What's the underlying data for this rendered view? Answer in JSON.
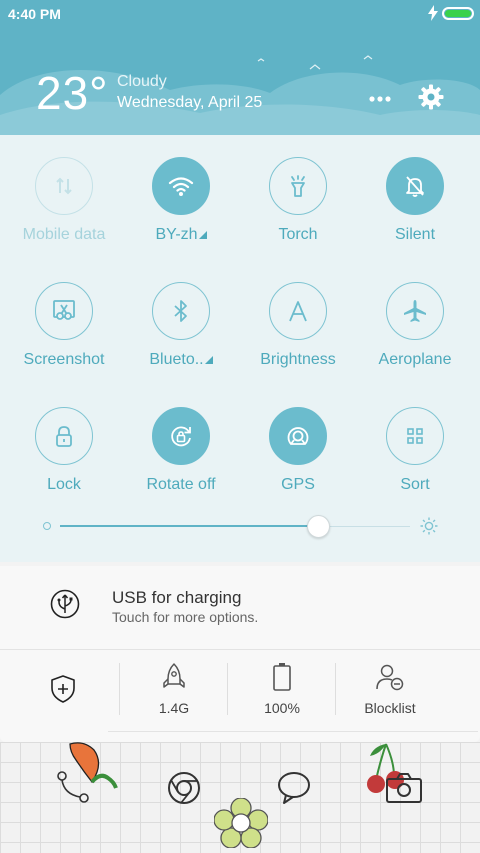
{
  "status": {
    "time": "4:40 PM"
  },
  "weather": {
    "temperature": "23°",
    "condition": "Cloudy",
    "date": "Wednesday, April 25"
  },
  "toggles": [
    {
      "label": "Mobile data",
      "icon": "mobile-data-icon",
      "state": "disabled"
    },
    {
      "label": "BY-zh",
      "icon": "wifi-icon",
      "state": "on",
      "expandable": true
    },
    {
      "label": "Torch",
      "icon": "torch-icon",
      "state": "off"
    },
    {
      "label": "Silent",
      "icon": "bell-off-icon",
      "state": "on"
    },
    {
      "label": "Screenshot",
      "icon": "scissors-icon",
      "state": "off"
    },
    {
      "label": "Blueto..",
      "icon": "bluetooth-icon",
      "state": "off",
      "expandable": true
    },
    {
      "label": "Brightness",
      "icon": "brightness-auto-icon",
      "state": "off"
    },
    {
      "label": "Aeroplane",
      "icon": "airplane-icon",
      "state": "off"
    },
    {
      "label": "Lock",
      "icon": "lock-icon",
      "state": "off"
    },
    {
      "label": "Rotate off",
      "icon": "rotate-lock-icon",
      "state": "on"
    },
    {
      "label": "GPS",
      "icon": "gps-icon",
      "state": "on"
    },
    {
      "label": "Sort",
      "icon": "grid-icon",
      "state": "off"
    }
  ],
  "brightness": {
    "level": 0.74
  },
  "notification": {
    "title": "USB for charging",
    "subtitle": "Touch for more options."
  },
  "actions": [
    {
      "label": "1.4G",
      "icon": "rocket-icon"
    },
    {
      "label": "100%",
      "icon": "battery-icon"
    },
    {
      "label": "Blocklist",
      "icon": "blocklist-icon"
    }
  ],
  "colors": {
    "accent": "#5fb3c6",
    "toggle_on": "#6bbccd",
    "label": "#4eaabc"
  }
}
